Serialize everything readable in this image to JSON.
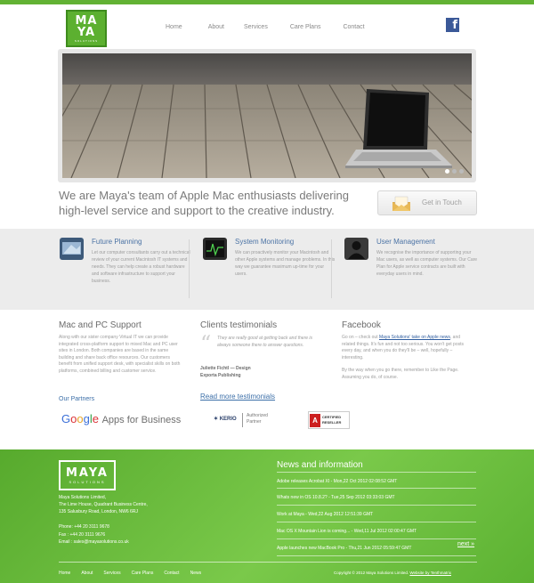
{
  "brand": {
    "logo_line1": "MA",
    "logo_line2": "YA",
    "logo_sub": "SOLUTIONS",
    "green": "#62b234",
    "link_blue": "#3c6fa8"
  },
  "nav": [
    "Home",
    "About",
    "Services",
    "Care Plans",
    "Contact"
  ],
  "facebook_icon": "facebook-icon",
  "hero": {
    "slides": 3,
    "active_slide": 1
  },
  "tagline": "We are Maya's team of Apple Mac enthusiasts delivering high-level service and support to the creative industry.",
  "cta": {
    "label": "Get in Touch",
    "icon": "envelope-icon"
  },
  "features": [
    {
      "title": "Future Planning",
      "icon": "planning-icon",
      "text": "Let our computer consultants carry out a technical review of your current Macintosh IT systems and needs. They can help create a robust hardware and software infrastructure to support your business."
    },
    {
      "title": "System Monitoring",
      "icon": "monitoring-icon",
      "text": "We can proactively monitor your Macintosh and other Apple systems and manage problems. In this way we guarantee maximum up-time for your users."
    },
    {
      "title": "User Management",
      "icon": "user-icon",
      "text": "We recognise the importance of supporting your Mac users, as well as computer systems. Our Care Plan for Apple service contracts are built with everyday users in mind."
    }
  ],
  "support": {
    "title": "Mac and PC Support",
    "text": "Along with our sister company Virtual IT we can provide integrated cross-platform support to mixed Mac and PC user sites in London. Both companies are based in the same building and share back office resources. Our customers benefit from unified support desk, with specialist skills on both platforms, combined billing and customer service."
  },
  "partners": {
    "title": "Our Partners",
    "google_letters": [
      "G",
      "o",
      "o",
      "g",
      "l",
      "e"
    ],
    "google_rest": "Apps for Business",
    "kerio": "✶ KERIO",
    "kerio_badge_1": "Authorized",
    "kerio_badge_2": "Partner",
    "adobe_mark": "A",
    "adobe_1": "CERTIFIED",
    "adobe_2": "RESELLER"
  },
  "testimonials": {
    "title": "Clients testimonials",
    "quote": "They are really good at getting back and there is always someone there to answer questions.",
    "name": "Juliette Fichtl — Design",
    "company": "Exporta Publishing",
    "more": "Read more testimonials"
  },
  "facebook": {
    "title": "Facebook",
    "pre": "Go on – check out ",
    "link": "Maya Solutions' take on Apple news",
    "post": ", and related things. It's fun and not too serious. You won't get posts every day, and when you do they'll be – well, hopefully – interesting.",
    "para2": "By the way when you go there, remember to Like the Page. Assuming you do, of course."
  },
  "footer": {
    "logo": "MAYA",
    "logo_sub": "SOLUTIONS",
    "address": [
      "Maya Solutions Limited,",
      "The Lime House, Quadrant Business Centre,",
      "135 Salusbury Road, London, NW6 6RJ"
    ],
    "phone": "Phone: +44 20 3111 9678",
    "fax": "Fax : +44 20 3111 9676",
    "email": "Email : sales@mayasolutions.co.uk",
    "news_title": "News and information",
    "news": [
      "Adobe releases Acrobat XI - Mon,22 Oct 2012 02:08:52 GMT",
      "Whats new in OS 10.8.2? - Tue,25 Sep 2012 03:33:03 GMT",
      "Work at Maya - Wed,22 Aug 2012 12:51:39 GMT",
      "Mac OS X Mountain Lion is coming... - Wed,11 Jul 2012 02:00:47 GMT",
      "Apple launches new MacBook Pro - Thu,21 Jun 2012 05:59:47 GMT"
    ],
    "next": "next »",
    "nav": [
      "Home",
      "About",
      "Services",
      "Care Plans",
      "Contact",
      "News"
    ],
    "copyright": "Copyright © 2012 Maya Solutions Limited.",
    "credit": "Website by Tenthmatrix"
  }
}
